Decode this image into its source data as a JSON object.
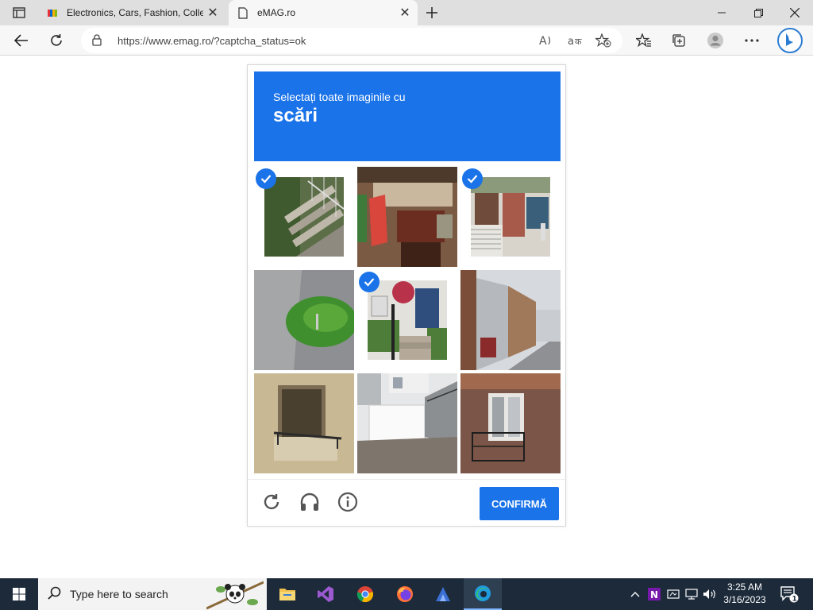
{
  "browser": {
    "tabs": [
      {
        "title": "Electronics, Cars, Fashion, Collect",
        "favicon": "ebay-favicon",
        "active": false
      },
      {
        "title": "eMAG.ro",
        "favicon": "document-favicon",
        "active": true
      }
    ],
    "url": "https://www.emag.ro/?captcha_status=ok",
    "new_tab_icon": "plus-icon"
  },
  "captcha": {
    "prompt_line1": "Selectați toate imaginile cu",
    "prompt_keyword": "scări",
    "accent": "#1a73e8",
    "tiles": [
      {
        "subject": "outdoor stone stairs with railing",
        "selected": true
      },
      {
        "subject": "building entrance with red flag",
        "selected": false
      },
      {
        "subject": "house front with staircase",
        "selected": true
      },
      {
        "subject": "sidewalk with grass patch",
        "selected": false
      },
      {
        "subject": "front door with steps and flower basket",
        "selected": true
      },
      {
        "subject": "row houses street",
        "selected": false
      },
      {
        "subject": "building balcony",
        "selected": false
      },
      {
        "subject": "white garage with outside stairs",
        "selected": false
      },
      {
        "subject": "brick facade with balcony",
        "selected": false
      }
    ],
    "footer": {
      "reload_icon": "reload-icon",
      "audio_icon": "headphones-icon",
      "info_icon": "info-icon",
      "verify_label": "CONFIRMĂ"
    }
  },
  "taskbar": {
    "search_placeholder": "Type here to search",
    "apps": [
      "file-explorer-icon",
      "visual-studio-icon",
      "chrome-icon",
      "firefox-icon",
      "app-icon",
      "edge-icon"
    ],
    "time": "3:25 AM",
    "date": "3/16/2023",
    "notification_count": "1"
  }
}
